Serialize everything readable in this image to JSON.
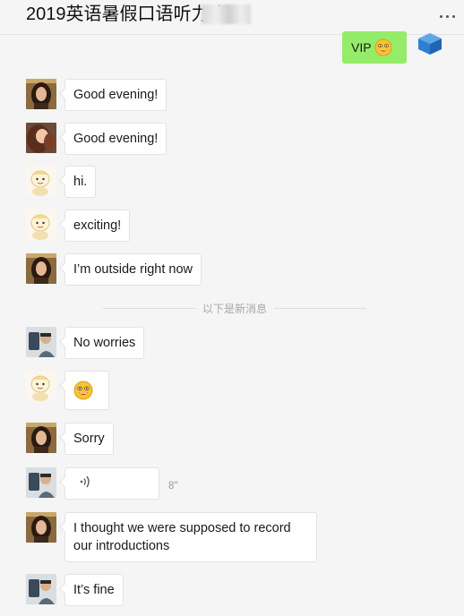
{
  "header": {
    "title": "2019英语暑假口语听力班"
  },
  "sent": {
    "text": "VIP",
    "emoji": "grinning-emoji"
  },
  "messages": [
    {
      "sender": "woman-dark-hair",
      "text": "Good evening!"
    },
    {
      "sender": "woman-curly-hair",
      "text": "Good evening!"
    },
    {
      "sender": "cartoon-baby",
      "text": "hi."
    },
    {
      "sender": "cartoon-baby",
      "text": "exciting!"
    },
    {
      "sender": "woman-dark-hair",
      "text": "I’m outside right now"
    },
    {
      "sender": "man-selfie",
      "text": "No worries"
    },
    {
      "sender": "cartoon-baby",
      "text": "",
      "emoji": "grinning-emoji"
    },
    {
      "sender": "woman-dark-hair",
      "text": "Sorry"
    },
    {
      "sender": "man-selfie",
      "type": "voice",
      "duration": "8\""
    },
    {
      "sender": "woman-dark-hair",
      "text": "I thought we were supposed to record our introductions"
    },
    {
      "sender": "man-selfie",
      "text": "It’s fine"
    }
  ],
  "divider": {
    "text": "以下是新消息"
  },
  "colors": {
    "sent_bubble": "#95ec69",
    "received_bubble": "#ffffff",
    "background": "#f5f5f5"
  }
}
